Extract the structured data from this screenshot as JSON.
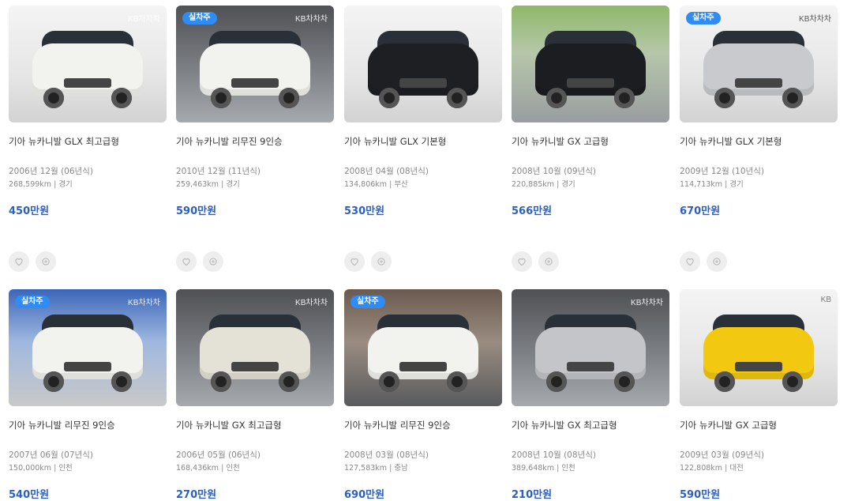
{
  "listings": [
    {
      "title": "기아 뉴카니발 GLX 최고급형",
      "year": "2006년 12월 (06년식)",
      "km": "268,599km",
      "region": "경기",
      "price": "450만원",
      "badge": "",
      "watermark": "KB차차차"
    },
    {
      "title": "기아 뉴카니발 리무진 9인승",
      "year": "2010년 12월 (11년식)",
      "km": "259,463km",
      "region": "경기",
      "price": "590만원",
      "badge": "실차주",
      "watermark": "KB차차차"
    },
    {
      "title": "기아 뉴카니발 GLX 기본형",
      "year": "2008년 04월 (08년식)",
      "km": "134,806km",
      "region": "부산",
      "price": "530만원",
      "badge": "",
      "watermark": ""
    },
    {
      "title": "기아 뉴카니발 GX 고급형",
      "year": "2008년 10월 (09년식)",
      "km": "220,885km",
      "region": "경기",
      "price": "566만원",
      "badge": "",
      "watermark": ""
    },
    {
      "title": "기아 뉴카니발 GLX 기본형",
      "year": "2009년 12월 (10년식)",
      "km": "114,713km",
      "region": "경기",
      "price": "670만원",
      "badge": "실차주",
      "watermark": "KB차차차"
    },
    {
      "title": "기아 뉴카니발 리무진 9인승",
      "year": "2007년 06월 (07년식)",
      "km": "150,000km",
      "region": "인천",
      "price": "540만원",
      "badge": "실차주",
      "watermark": "KB차차차"
    },
    {
      "title": "기아 뉴카니발 GX 최고급형",
      "year": "2006년 05월 (06년식)",
      "km": "168,436km",
      "region": "인천",
      "price": "270만원",
      "badge": "",
      "watermark": "KB차차차"
    },
    {
      "title": "기아 뉴카니발 리무진 9인승",
      "year": "2008년 03월 (08년식)",
      "km": "127,583km",
      "region": "충남",
      "price": "690만원",
      "badge": "실차주",
      "watermark": ""
    },
    {
      "title": "기아 뉴카니발 GX 최고급형",
      "year": "2008년 10월 (08년식)",
      "km": "389,648km",
      "region": "인천",
      "price": "210만원",
      "badge": "",
      "watermark": "KB차차차"
    },
    {
      "title": "기아 뉴카니발 GX 고급형",
      "year": "2009년 03월 (09년식)",
      "km": "122,808km",
      "region": "대전",
      "price": "590만원",
      "badge": "",
      "watermark": "KB"
    }
  ],
  "separator": "|",
  "colors": {
    "price": "#2a5fc4",
    "badge": "#2f8cf5",
    "muted": "#888888"
  },
  "icons": {
    "favorite": "heart-icon",
    "compare": "compare-icon"
  }
}
